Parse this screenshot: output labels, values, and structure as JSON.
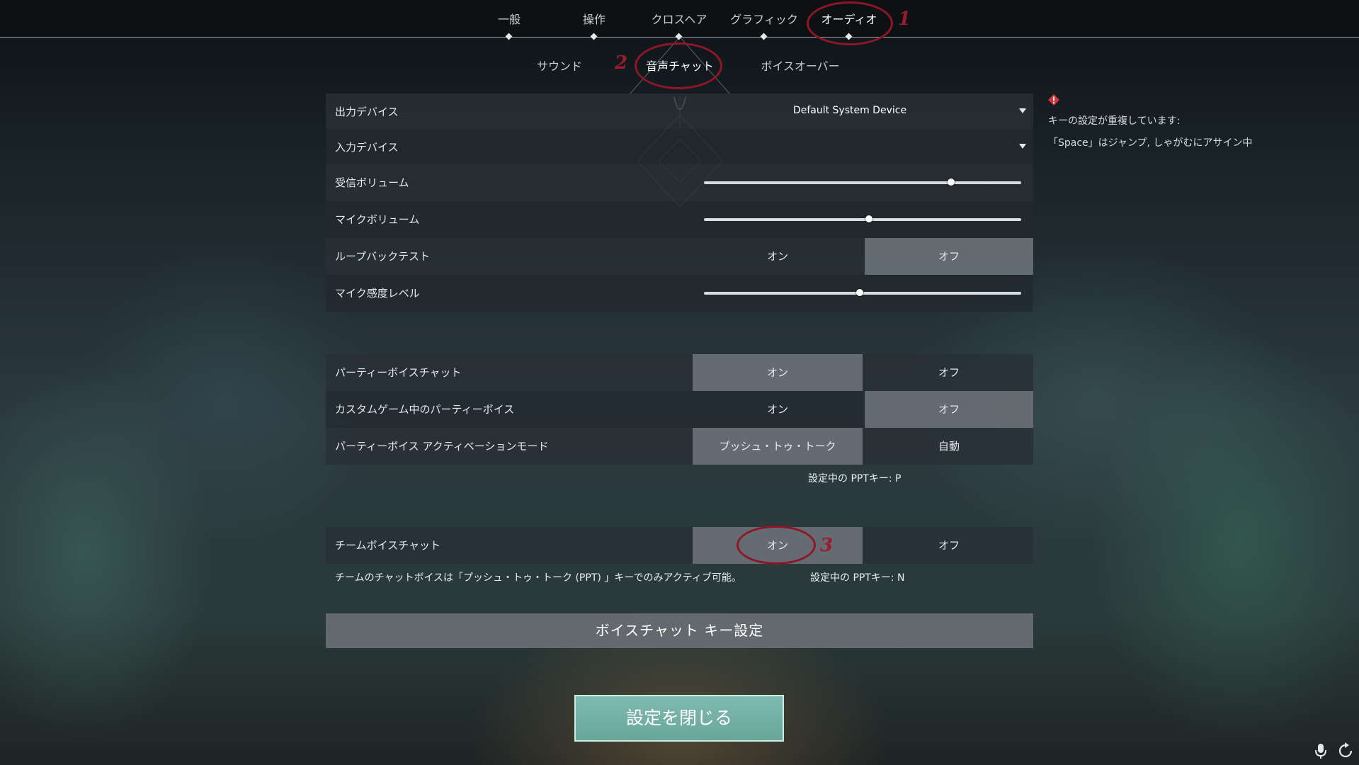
{
  "top_tabs": [
    "一般",
    "操作",
    "クロスヘア",
    "グラフィック",
    "オーディオ"
  ],
  "active_top_tab": "オーディオ",
  "sub_tabs": [
    "サウンド",
    "音声チャット",
    "ボイスオーバー"
  ],
  "active_sub_tab": "音声チャット",
  "devices": {
    "output_label": "出力デバイス",
    "output_value": "Default System Device",
    "input_label": "入力デバイス",
    "input_value": ""
  },
  "sliders": {
    "receive_label": "受信ボリューム",
    "receive_level": 0.78,
    "mic_label": "マイクボリューム",
    "mic_level": 0.52,
    "sensitivity_label": "マイク感度レベル",
    "sensitivity_level": 0.49
  },
  "loopback": {
    "label": "ループバックテスト",
    "on": "オン",
    "off": "オフ",
    "selected": "off"
  },
  "party_voice": {
    "label": "パーティーボイスチャット",
    "on": "オン",
    "off": "オフ",
    "selected": "on"
  },
  "custom_party_voice": {
    "label": "カスタムゲーム中のパーティーボイス",
    "on": "オン",
    "off": "オフ",
    "selected": "off"
  },
  "activation_mode": {
    "label": "パーティーボイス アクティベーションモード",
    "ptt": "プッシュ・トゥ・トーク",
    "auto": "自動",
    "selected": "ptt"
  },
  "party_ppt_key": "設定中の PPTキー: P",
  "team_voice": {
    "label": "チームボイスチャット",
    "on": "オン",
    "off": "オフ",
    "selected": "on"
  },
  "team_note": "チームのチャットボイスは「プッシュ・トゥ・トーク (PPT) 」キーでのみアクティブ可能。",
  "team_ppt_key": "設定中の PPTキー: N",
  "keybind_button": "ボイスチャット キー設定",
  "close_button": "設定を閉じる",
  "warning": {
    "title": "キーの設定が重複しています:",
    "body": "「Space」はジャンプ, しゃがむにアサイン中"
  },
  "annotations": [
    "1",
    "2",
    "3"
  ],
  "colors": {
    "annotation": "#9e1b2d",
    "close_button": "#73b0a5",
    "selected_segment": "#6e767c"
  }
}
